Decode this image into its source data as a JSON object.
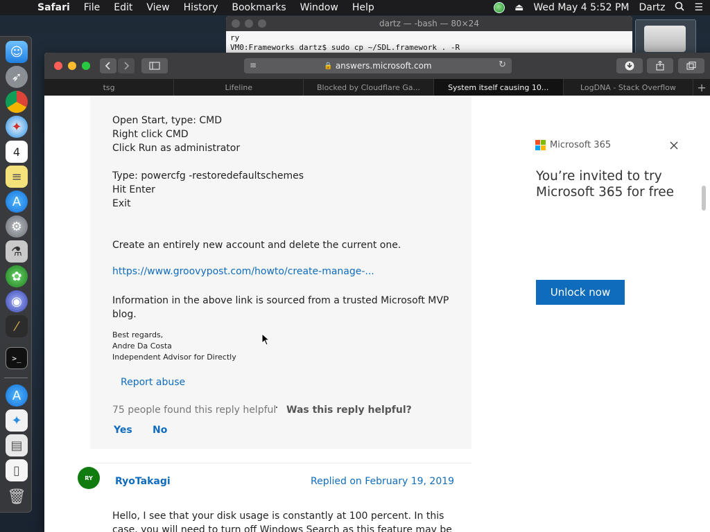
{
  "menubar": {
    "app": "Safari",
    "items": [
      "File",
      "Edit",
      "View",
      "History",
      "Bookmarks",
      "Window",
      "Help"
    ],
    "clock": "Wed May 4  5:52 PM",
    "user": "Dartz"
  },
  "terminal": {
    "title": "dartz — -bash — 80×24",
    "line1": "ry",
    "line2": "VM0:Frameworks dartz$ sudo cp ~/SDL.framework . -R"
  },
  "safari": {
    "url": "answers.microsoft.com",
    "tabs": [
      "tsg",
      "Lifeline",
      "Blocked by Cloudflare Ga...",
      "System itself causing 10...",
      "LogDNA - Stack Overflow"
    ],
    "active_tab": 3
  },
  "reply": {
    "lines": [
      "Open Start, type: CMD",
      "Right click CMD",
      "Click Run as administrator",
      "Type: powercfg -restoredefaultschemes",
      "Hit Enter",
      "Exit",
      "Create an entirely new account and delete the current one.",
      "Information in the above link is sourced from a trusted Microsoft MVP",
      "blog."
    ],
    "link": "https://www.groovypost.com/howto/create-manage-...",
    "signature": [
      "Best regards,",
      "Andre Da Costa",
      "Independent Advisor for Directly"
    ],
    "report": "Report abuse",
    "helpful_count": "75 people found this reply helpful",
    "helpful_question": "Was this reply helpful?",
    "yes": "Yes",
    "no": "No"
  },
  "reply2": {
    "avatar": "RY",
    "author": "RyoTakagi",
    "date": "Replied on February 19, 2019",
    "text": "Hello, I see that your disk usage is constantly at 100 percent. In this case, you will need to turn off Windows Search as this feature may be the one"
  },
  "ad": {
    "brand": "Microsoft 365",
    "title": "You’re invited to try Microsoft 365 for free",
    "button": "Unlock now"
  },
  "colors": {
    "link": "#0f6cbd",
    "ms_red": "#f25022",
    "ms_green": "#7fba00",
    "ms_blue": "#00a4ef",
    "ms_yellow": "#ffb900"
  }
}
